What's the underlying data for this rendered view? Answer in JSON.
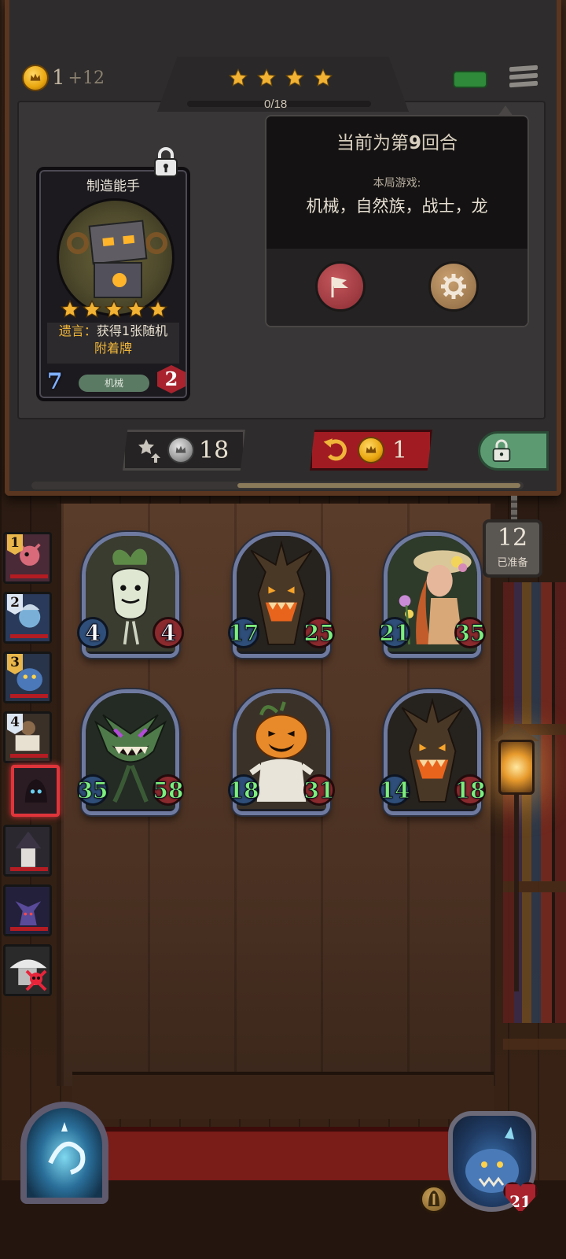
{
  "header": {
    "gold": "1",
    "gold_income": "+12",
    "star_count": 4,
    "progress_text": "0/18"
  },
  "card": {
    "name": "制造能手",
    "stars": 5,
    "deathrattle_prefix": "遗言：",
    "deathrattle_text": "获得1张随机",
    "deathrattle_keyword": "附着牌",
    "tribe": "机械",
    "attack": "7",
    "health": "2"
  },
  "info_panel": {
    "round_prefix": "当前为第",
    "round_number": "9",
    "round_suffix": "回合",
    "game_label": "本局游戏:",
    "tribes": "机械，自然族，战士，龙"
  },
  "actions": {
    "upgrade_cost": "18",
    "refresh_cost": "1"
  },
  "board": {
    "minions": [
      {
        "attack": "4",
        "health": "4",
        "atk_buffed": false,
        "hp_buffed": false,
        "art": "mandrake"
      },
      {
        "attack": "17",
        "health": "25",
        "atk_buffed": true,
        "hp_buffed": true,
        "art": "treant"
      },
      {
        "attack": "21",
        "health": "35",
        "atk_buffed": true,
        "hp_buffed": true,
        "art": "flower-girl"
      },
      {
        "attack": "35",
        "health": "58",
        "atk_buffed": true,
        "hp_buffed": true,
        "art": "carnivorous-plant"
      },
      {
        "attack": "18",
        "health": "31",
        "atk_buffed": true,
        "hp_buffed": true,
        "art": "pumpkin"
      },
      {
        "attack": "14",
        "health": "18",
        "atk_buffed": true,
        "hp_buffed": true,
        "art": "treant"
      }
    ]
  },
  "ranking": {
    "badges": [
      "1",
      "2",
      "3",
      "4"
    ]
  },
  "ready": {
    "count": "12",
    "label": "已准备"
  },
  "hero": {
    "health": "21"
  },
  "colors": {
    "gold": "#e9a60f",
    "buffed_stat": "#7cf07c",
    "refresh_red": "#a01c22",
    "freeze_green": "#5c9b72"
  }
}
